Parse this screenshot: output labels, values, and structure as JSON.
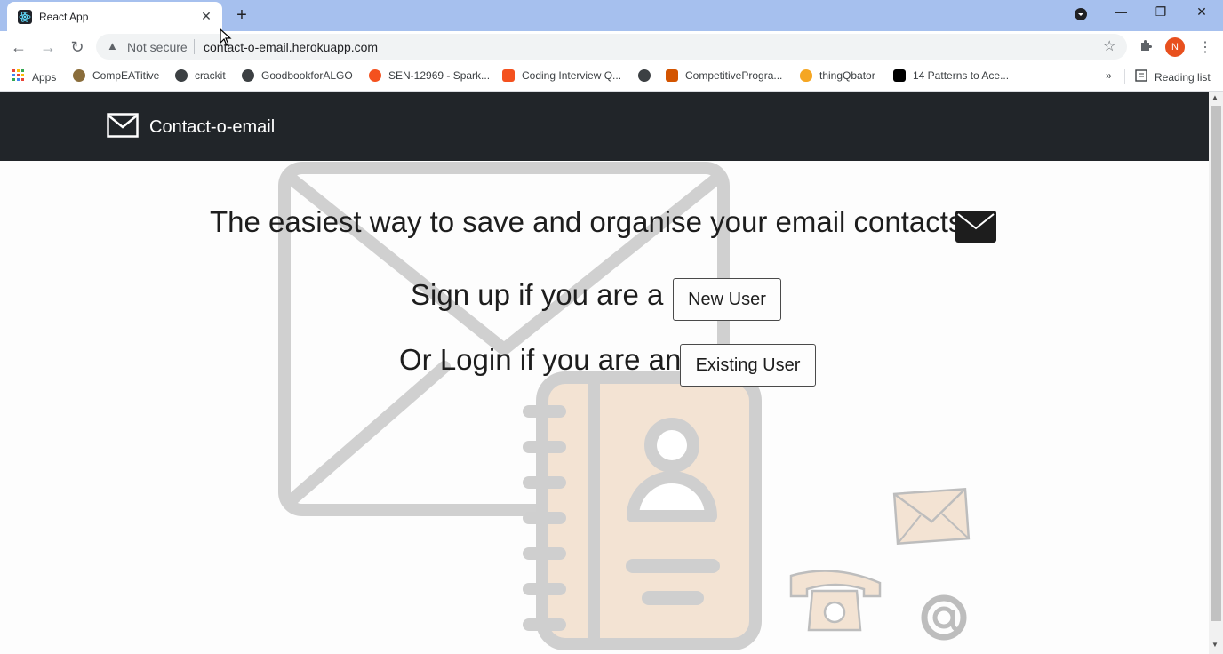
{
  "browser": {
    "tab_title": "React App",
    "new_tab_symbol": "+",
    "address": {
      "security_label": "Not secure",
      "url": "contact-o-email.herokuapp.com"
    },
    "profile_initial": "N",
    "bookmarks": [
      {
        "label": "Apps",
        "icon": "apps-grid-icon",
        "color": "#ea4335"
      },
      {
        "label": "CompEATitive",
        "icon": "owl-icon",
        "color": "#8a6d3b"
      },
      {
        "label": "crackit",
        "icon": "globe-icon",
        "color": "#3c4043"
      },
      {
        "label": "GoodbookforALGO",
        "icon": "globe-icon",
        "color": "#3c4043"
      },
      {
        "label": "SEN-12969 - Spark...",
        "icon": "jira-icon",
        "color": "#f4511e"
      },
      {
        "label": "Coding Interview Q...",
        "icon": "coding-icon",
        "color": "#f4511e"
      },
      {
        "label": "",
        "icon": "globe-icon",
        "color": "#3c4043"
      },
      {
        "label": "CompetitiveProgra...",
        "icon": "book-icon",
        "color": "#d35400"
      },
      {
        "label": "thingQbator",
        "icon": "egg-icon",
        "color": "#f5a623"
      },
      {
        "label": "14 Patterns to Ace...",
        "icon": "medium-icon",
        "color": "#000000"
      }
    ],
    "overflow_symbol": "»",
    "reading_list_label": "Reading list"
  },
  "navbar": {
    "brand": "Contact-o-email"
  },
  "hero": {
    "headline": "The easiest way to save and organise your email contacts",
    "signup_text": "Sign up if you are a",
    "signup_button": "New User",
    "login_text": "Or Login if you are an",
    "login_button": "Existing User"
  },
  "colors": {
    "navbar_bg": "#212529",
    "page_bg": "#fdfdfd",
    "tabstrip_bg": "#a6c0ee",
    "art_gray": "#cfcfcf",
    "art_peach": "#f3e3d3"
  }
}
